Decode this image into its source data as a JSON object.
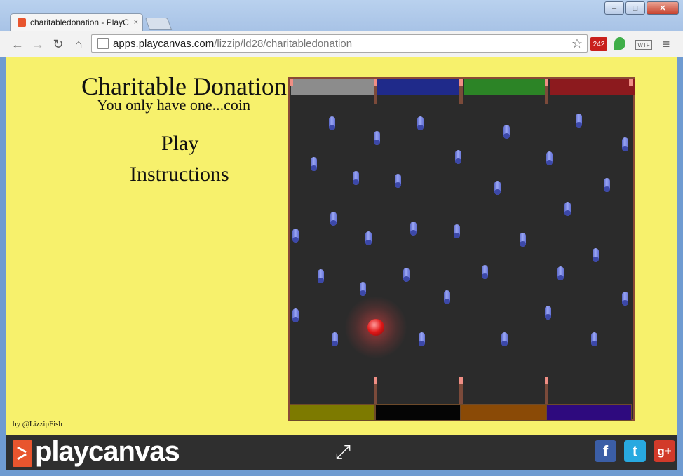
{
  "browser": {
    "tab_title": "charitabledonation - PlayC",
    "tab_close": "×",
    "url_host": "apps.playcanvas.com",
    "url_path": "/lizzip/ld28/charitabledonation",
    "window_controls": {
      "minimize": "–",
      "maximize": "□",
      "close": "✕"
    },
    "nav": {
      "back": "←",
      "forward": "→",
      "reload": "↻",
      "home": "⌂",
      "star": "☆",
      "menu": "≡"
    },
    "extensions": {
      "gmail_badge": "242",
      "wtf": "WTF"
    }
  },
  "game": {
    "title": "Charitable Donation",
    "subtitle": "You only have one...coin",
    "menu": {
      "play": "Play",
      "instructions": "Instructions"
    },
    "credit": "by @LizzipFish",
    "top_bins": [
      {
        "color": "#8c8c8c"
      },
      {
        "color": "#1f2a8a"
      },
      {
        "color": "#2c8426"
      },
      {
        "color": "#8c1a1e"
      }
    ],
    "bottom_slots": [
      {
        "color": "#7d7a00"
      },
      {
        "color": "#050505"
      },
      {
        "color": "#8a4a06"
      },
      {
        "color": "#2e0a7e"
      }
    ],
    "coin_color": "#e01818",
    "peg_color": "#7a86e6"
  },
  "footer": {
    "logo_text": "playcanvas",
    "fullscreen_icon": "⤢",
    "social": {
      "facebook": "f",
      "twitter": "t",
      "google_plus": "g+"
    }
  }
}
